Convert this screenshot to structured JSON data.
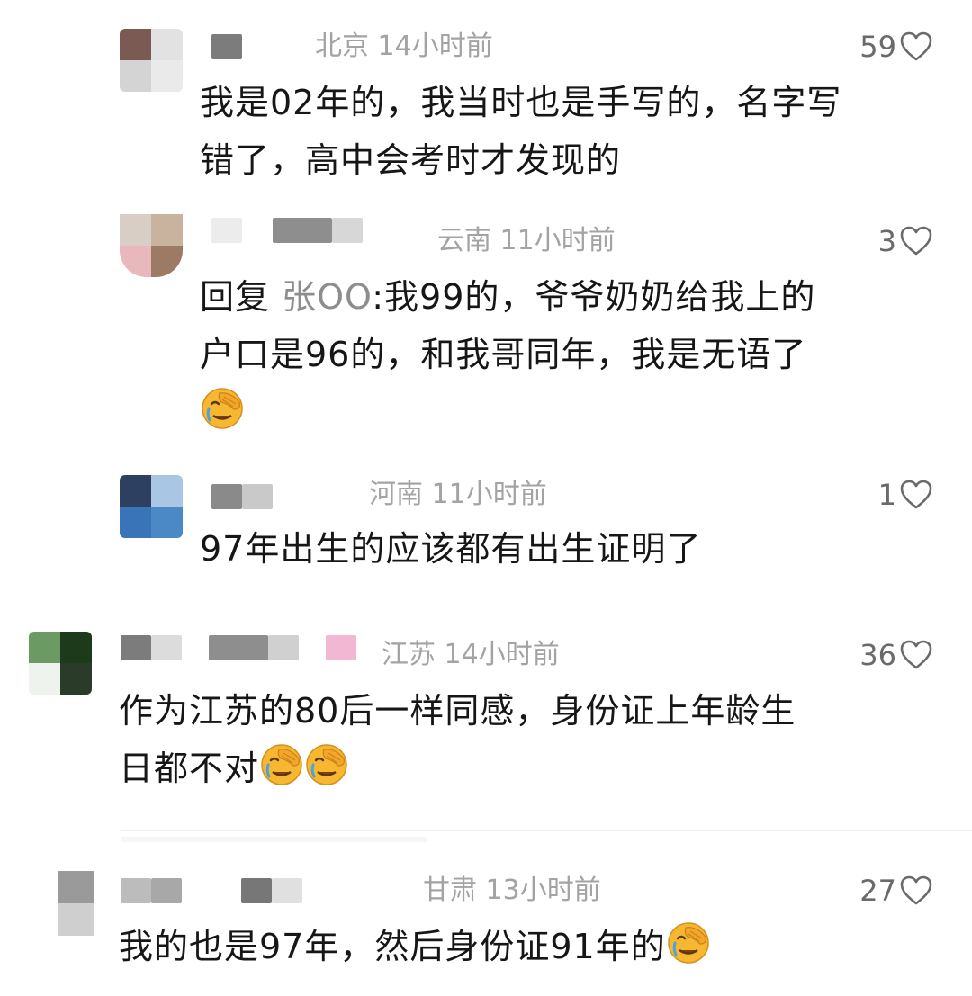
{
  "comments": [
    {
      "id": "c1",
      "location_time": "北京 14小时前",
      "likes": "59",
      "text": "我是02年的，我当时也是手写的，名字写错了，高中会考时才发现的",
      "lines": [
        "我是02年的，我当时也是手写的，名字写",
        "错了，高中会考时才发现的"
      ]
    },
    {
      "id": "c2",
      "location_time": "云南 11小时前",
      "likes": "3",
      "reply_prefix": "回复 ",
      "reply_name": "张OO",
      "lines": [
        ":我99的，爷爷奶奶给我上的",
        "户口是96的，和我哥同年，我是无语了"
      ]
    },
    {
      "id": "c3",
      "location_time": "河南 11小时前",
      "likes": "1",
      "lines": [
        "97年出生的应该都有出生证明了"
      ]
    },
    {
      "id": "c4",
      "location_time": "江苏 14小时前",
      "likes": "36",
      "lines": [
        "作为江苏的80后一样同感，身份证上年龄生",
        "日都不对"
      ]
    },
    {
      "id": "c5",
      "location_time": "甘肃 13小时前",
      "likes": "27",
      "lines": [
        "我的也是97年，然后身份证91年的"
      ]
    }
  ],
  "icons": {
    "heart": "heart-outline-icon",
    "emoji": "facepalm-crying-emoji"
  },
  "colors": {
    "meta": "#a3a3a3",
    "reply_name": "#8d8d8d",
    "text": "#161616",
    "emoji": "#f7b731"
  }
}
